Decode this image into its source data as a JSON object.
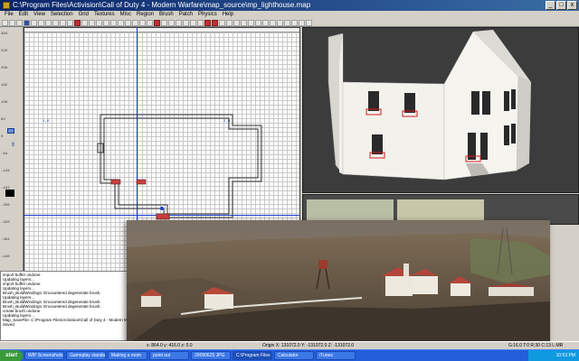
{
  "titlebar": {
    "title": "C:\\Program Files\\Activision\\Call of Duty 4 - Modern Warfare\\map_source\\mp_lighthouse.map"
  },
  "window_controls": {
    "minimize": "_",
    "maximize": "□",
    "close": "x"
  },
  "menu": [
    "File",
    "Edit",
    "View",
    "Selection",
    "Grid",
    "Textures",
    "Misc",
    "Region",
    "Brush",
    "Patch",
    "Physics",
    "Help"
  ],
  "grid_view": {
    "left_ruler_ticks": [
      "384",
      "320",
      "256",
      "192",
      "128",
      "64",
      "0",
      "-64",
      "-128",
      "-192",
      "-256",
      "-320",
      "-384",
      "-448",
      "-512",
      "-576"
    ],
    "coord_labels": [
      "1,0",
      "2,0"
    ]
  },
  "console": {
    "lines": [
      "import buffer undone",
      "Updating layers...",
      "import buffer undone",
      "Updating layers...",
      "Brush_BuildWindings: Encountered degenerate brush.",
      "Updating layers...",
      "Brush_BuildWindings: Encountered degenerate brush.",
      "Brush_BuildWindings: Encountered degenerate brush.",
      "create brush undone",
      "Updating layers...",
      "Map_SaveFile: C:\\Program Files\\Activision\\Call of Duty 4 - Modern Warfare\\m",
      "Saved."
    ]
  },
  "statusbar": {
    "xyz": "x: 864.0  y: 416.0  z: 0.0",
    "origin": "Origin X: 131072.0  Y: -131072.0  Z: -131072.0",
    "grid": "G:16.0 T:0 R:30 C:13 L:MR"
  },
  "taskbar": {
    "start": "start",
    "tasks": [
      "WIP Screenshots",
      "Gameplay standards",
      "Making a room",
      "point our",
      "20090625 JPG",
      "C:\\Program Files",
      "Calculator",
      "iTunes"
    ],
    "clock": "10:53 PM"
  }
}
